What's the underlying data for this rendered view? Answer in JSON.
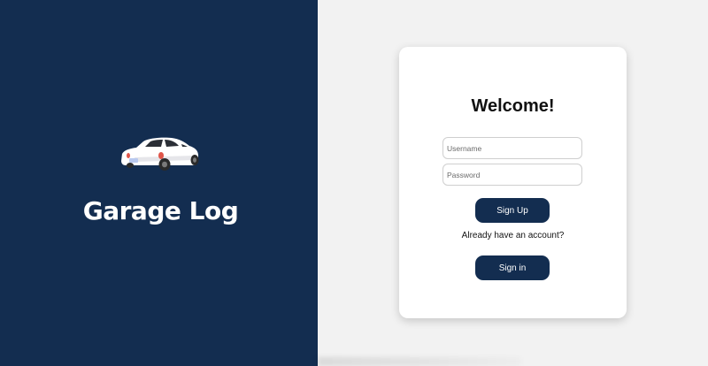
{
  "brand": {
    "name": "Garage Log",
    "logo_icon": "car-icon",
    "panel_color": "#132d50"
  },
  "card": {
    "heading": "Welcome!",
    "username": {
      "placeholder": "Username",
      "value": ""
    },
    "password": {
      "placeholder": "Password",
      "value": ""
    },
    "signup_label": "Sign Up",
    "already_text": "Already have an account?",
    "signin_label": "Sign in",
    "button_color": "#132d50"
  }
}
